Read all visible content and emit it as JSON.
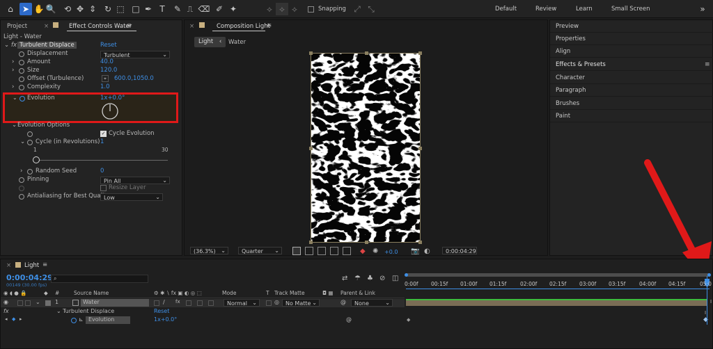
{
  "toolbar": {
    "snapping_label": "Snapping",
    "workspaces": [
      "Default",
      "Review",
      "Learn",
      "Small Screen"
    ],
    "active_workspace": "Default"
  },
  "left_tabs": {
    "project": "Project",
    "effect_controls": "Effect Controls Water"
  },
  "layer_path": "Light - Water",
  "effect": {
    "fx": "fx",
    "name": "Turbulent Displace",
    "reset": "Reset",
    "props": [
      {
        "label": "Displacement",
        "value": "Turbulent"
      },
      {
        "label": "Amount",
        "value": "40.0"
      },
      {
        "label": "Size",
        "value": "120.0"
      },
      {
        "label": "Offset (Turbulence)",
        "value": "600.0,1050.0"
      },
      {
        "label": "Complexity",
        "value": "1.0"
      },
      {
        "label": "Evolution",
        "value": "1x+0.0°"
      }
    ],
    "evolution_options": "Evolution Options",
    "cycle_evolution": "Cycle Evolution",
    "cycle_label": "Cycle (in Revolutions)",
    "cycle_value": "1",
    "slider_min": "1",
    "slider_max": "30",
    "random_seed": "Random Seed",
    "random_seed_value": "0",
    "pinning": "Pinning",
    "pinning_value": "Pin All",
    "resize_layer": "Resize Layer",
    "antialiasing": "Antialiasing for Best Quality",
    "antialiasing_value": "Low"
  },
  "comp": {
    "tab": "Composition Light",
    "crumb1": "Light",
    "crumb2": "Water",
    "zoom": "(36.3%)",
    "quality": "Quarter",
    "exposure": "+0.0",
    "timecode": "0:00:04:29"
  },
  "right_panels": [
    "Preview",
    "Properties",
    "Align",
    "Effects & Presets",
    "Character",
    "Paragraph",
    "Brushes",
    "Paint"
  ],
  "timeline": {
    "tab": "Light",
    "time": "0:00:04:29",
    "frames": "00149 (30.00 fps)",
    "search_placeholder": "",
    "headers": {
      "hash": "#",
      "source": "Source Name",
      "mode": "Mode",
      "t": "T",
      "track": "Track Matte",
      "parent": "Parent & Link"
    },
    "layer": {
      "num": "1",
      "name": "Water",
      "mode": "Normal",
      "matte": "No Matte",
      "parent": "None"
    },
    "effect_row": "Turbulent Displace",
    "reset": "Reset",
    "evolution_row": "Evolution",
    "evolution_val": "1x+0.0°",
    "ticks": [
      "0:00f",
      "00:15f",
      "01:00f",
      "01:15f",
      "02:00f",
      "02:15f",
      "03:00f",
      "03:15f",
      "04:00f",
      "04:15f",
      "05:0"
    ]
  },
  "colors": {
    "accent": "#2d6ac9",
    "blue_value": "#3e8fe6",
    "highlight": "#e01919",
    "layer_bar": "#7a6d55",
    "green_bar": "#3dbb3d"
  }
}
